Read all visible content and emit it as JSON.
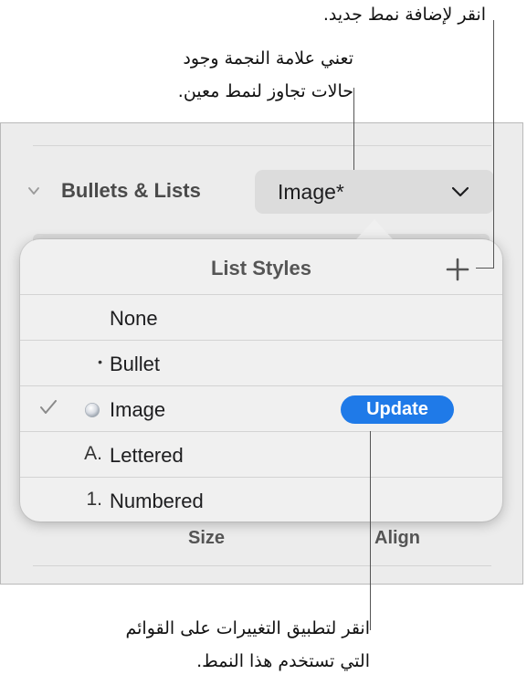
{
  "callouts": {
    "add_style": "انقر لإضافة نمط جديد.",
    "asterisk_line1": "تعني علامة النجمة وجود",
    "asterisk_line2": "حالات تجاوز لنمط معين.",
    "update_line1": "انقر لتطبيق التغييرات على القوائم",
    "update_line2": "التي تستخدم هذا النمط."
  },
  "inspector": {
    "section_title": "Bullets & Lists",
    "style_popup_value": "Image*"
  },
  "popover": {
    "title": "List Styles",
    "rows": [
      {
        "marker": "",
        "label": "None",
        "selected": false
      },
      {
        "marker": "•",
        "label": "Bullet",
        "selected": false
      },
      {
        "marker": "image-bullet-icon",
        "label": "Image",
        "selected": true
      },
      {
        "marker": "A.",
        "label": "Lettered",
        "selected": false
      },
      {
        "marker": "1.",
        "label": "Numbered",
        "selected": false
      }
    ],
    "update_label": "Update"
  },
  "columns": {
    "size_label": "Size",
    "align_label": "Align"
  },
  "colors": {
    "accent": "#1f7ae8",
    "panel_bg": "#ececec",
    "popover_bg": "#f0f0f0"
  }
}
